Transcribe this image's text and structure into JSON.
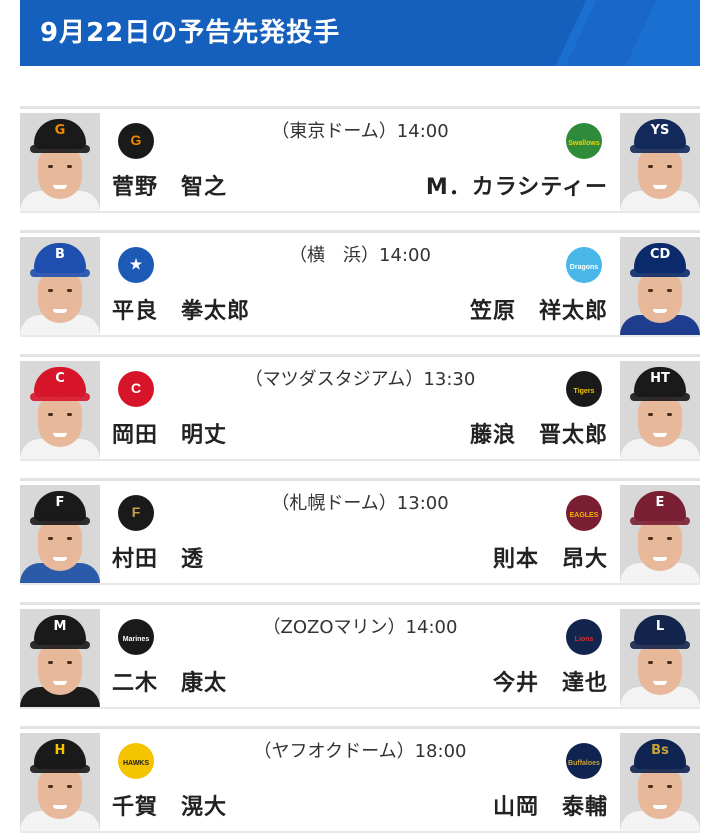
{
  "header": {
    "title": "9月22日の予告先発投手"
  },
  "games": [
    {
      "venue": "（東京ドーム）14:00",
      "home": {
        "pitcher": "菅野　智之",
        "team_logo": "giants-logo",
        "logo_text": "G",
        "cap_color": "#1a1a1a",
        "cap_mark_color": "#f08a00",
        "cap_mark": "G",
        "shirt_color": "#f3f3f3"
      },
      "away": {
        "pitcher": "M．カラシティー",
        "team_logo": "swallows-logo",
        "logo_text": "Swallows",
        "cap_color": "#132a5a",
        "cap_mark_color": "#ffffff",
        "cap_mark": "YS",
        "shirt_color": "#f3f3f3"
      }
    },
    {
      "venue": "（横　浜）14:00",
      "home": {
        "pitcher": "平良　拳太郎",
        "team_logo": "baystars-logo",
        "logo_text": "★",
        "cap_color": "#1f4fae",
        "cap_mark_color": "#ffffff",
        "cap_mark": "B",
        "shirt_color": "#f3f3f3"
      },
      "away": {
        "pitcher": "笠原　祥太郎",
        "team_logo": "dragons-logo",
        "logo_text": "Dragons",
        "cap_color": "#0a2a6b",
        "cap_mark_color": "#ffffff",
        "cap_mark": "CD",
        "shirt_color": "#1e3d8f"
      }
    },
    {
      "venue": "（マツダスタジアム）13:30",
      "home": {
        "pitcher": "岡田　明丈",
        "team_logo": "carp-logo",
        "logo_text": "C",
        "cap_color": "#d7152a",
        "cap_mark_color": "#ffffff",
        "cap_mark": "C",
        "shirt_color": "#f3f3f3"
      },
      "away": {
        "pitcher": "藤浪　晋太郎",
        "team_logo": "tigers-logo",
        "logo_text": "Tigers",
        "cap_color": "#1a1a1a",
        "cap_mark_color": "#ffffff",
        "cap_mark": "HT",
        "shirt_color": "#f3f3f3"
      }
    },
    {
      "venue": "（札幌ドーム）13:00",
      "home": {
        "pitcher": "村田　透",
        "team_logo": "fighters-logo",
        "logo_text": "F",
        "cap_color": "#1a1a1a",
        "cap_mark_color": "#ffffff",
        "cap_mark": "F",
        "shirt_color": "#2a5aa8"
      },
      "away": {
        "pitcher": "則本　昂大",
        "team_logo": "eagles-logo",
        "logo_text": "EAGLES",
        "cap_color": "#7a1f33",
        "cap_mark_color": "#ffffff",
        "cap_mark": "E",
        "shirt_color": "#f3f3f3"
      }
    },
    {
      "venue": "（ZOZOマリン）14:00",
      "home": {
        "pitcher": "二木　康太",
        "team_logo": "marines-logo",
        "logo_text": "Marines",
        "cap_color": "#1a1a1a",
        "cap_mark_color": "#ffffff",
        "cap_mark": "M",
        "shirt_color": "#1a1a1a"
      },
      "away": {
        "pitcher": "今井　達也",
        "team_logo": "lions-logo",
        "logo_text": "Lions",
        "cap_color": "#14254d",
        "cap_mark_color": "#ffffff",
        "cap_mark": "L",
        "shirt_color": "#f3f3f3"
      }
    },
    {
      "venue": "（ヤフオクドーム）18:00",
      "home": {
        "pitcher": "千賀　滉大",
        "team_logo": "hawks-logo",
        "logo_text": "HAWKS",
        "cap_color": "#1a1a1a",
        "cap_mark_color": "#f5c400",
        "cap_mark": "H",
        "shirt_color": "#f3f3f3"
      },
      "away": {
        "pitcher": "山岡　泰輔",
        "team_logo": "buffaloes-logo",
        "logo_text": "Buffaloes",
        "cap_color": "#0f2450",
        "cap_mark_color": "#c9a23a",
        "cap_mark": "Bs",
        "shirt_color": "#f3f3f3"
      }
    }
  ]
}
